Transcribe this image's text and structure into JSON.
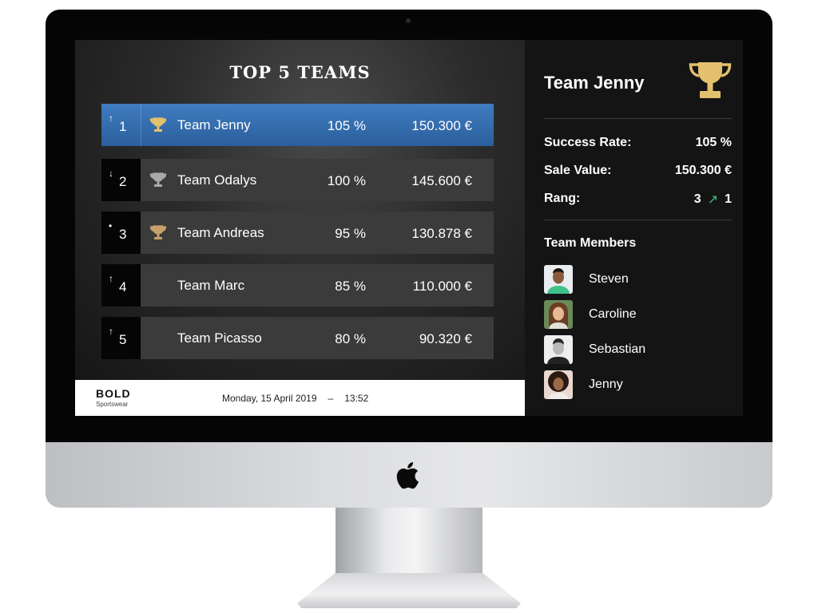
{
  "leaderboard": {
    "title": "TOP 5 TEAMS",
    "rows": [
      {
        "trend": "↑",
        "rank": "1",
        "team": "Team Jenny",
        "success": "105 %",
        "sales": "150.300  €",
        "trophy": "gold"
      },
      {
        "trend": "↓",
        "rank": "2",
        "team": "Team Odalys",
        "success": "100 %",
        "sales": "145.600  €",
        "trophy": "silver"
      },
      {
        "trend": "•",
        "rank": "3",
        "team": "Team Andreas",
        "success": "95 %",
        "sales": "130.878  €",
        "trophy": "bronze"
      },
      {
        "trend": "↑",
        "rank": "4",
        "team": "Team Marc",
        "success": "85 %",
        "sales": "110.000  €",
        "trophy": null
      },
      {
        "trend": "↑",
        "rank": "5",
        "team": "Team Picasso",
        "success": "80 %",
        "sales": "90.320  €",
        "trophy": null
      }
    ]
  },
  "footer": {
    "brand_name": "BOLD",
    "brand_sub": "Sportswear",
    "date": "Monday, 15 April 2019",
    "separator": "–",
    "time": "13:52"
  },
  "detail": {
    "team": "Team Jenny",
    "success_label": "Success Rate:",
    "success_value": "105 %",
    "sale_label": "Sale Value:",
    "sale_value": "150.300 €",
    "rang_label": "Rang:",
    "rang_from": "3",
    "rang_arrow": "↗",
    "rang_to": "1",
    "members_title": "Team Members",
    "members": [
      {
        "name": "Steven",
        "icon": "avatar-man-green-shirt"
      },
      {
        "name": "Caroline",
        "icon": "avatar-woman-smiling"
      },
      {
        "name": "Sebastian",
        "icon": "avatar-man-bw"
      },
      {
        "name": "Jenny",
        "icon": "avatar-woman-curly-hair"
      }
    ]
  },
  "colors": {
    "highlight_row": "#2f68a8",
    "gold": "#e3c06d",
    "silver": "#a9a9a9",
    "bronze": "#c9a06a",
    "rang_arrow": "#3fbf7f"
  }
}
